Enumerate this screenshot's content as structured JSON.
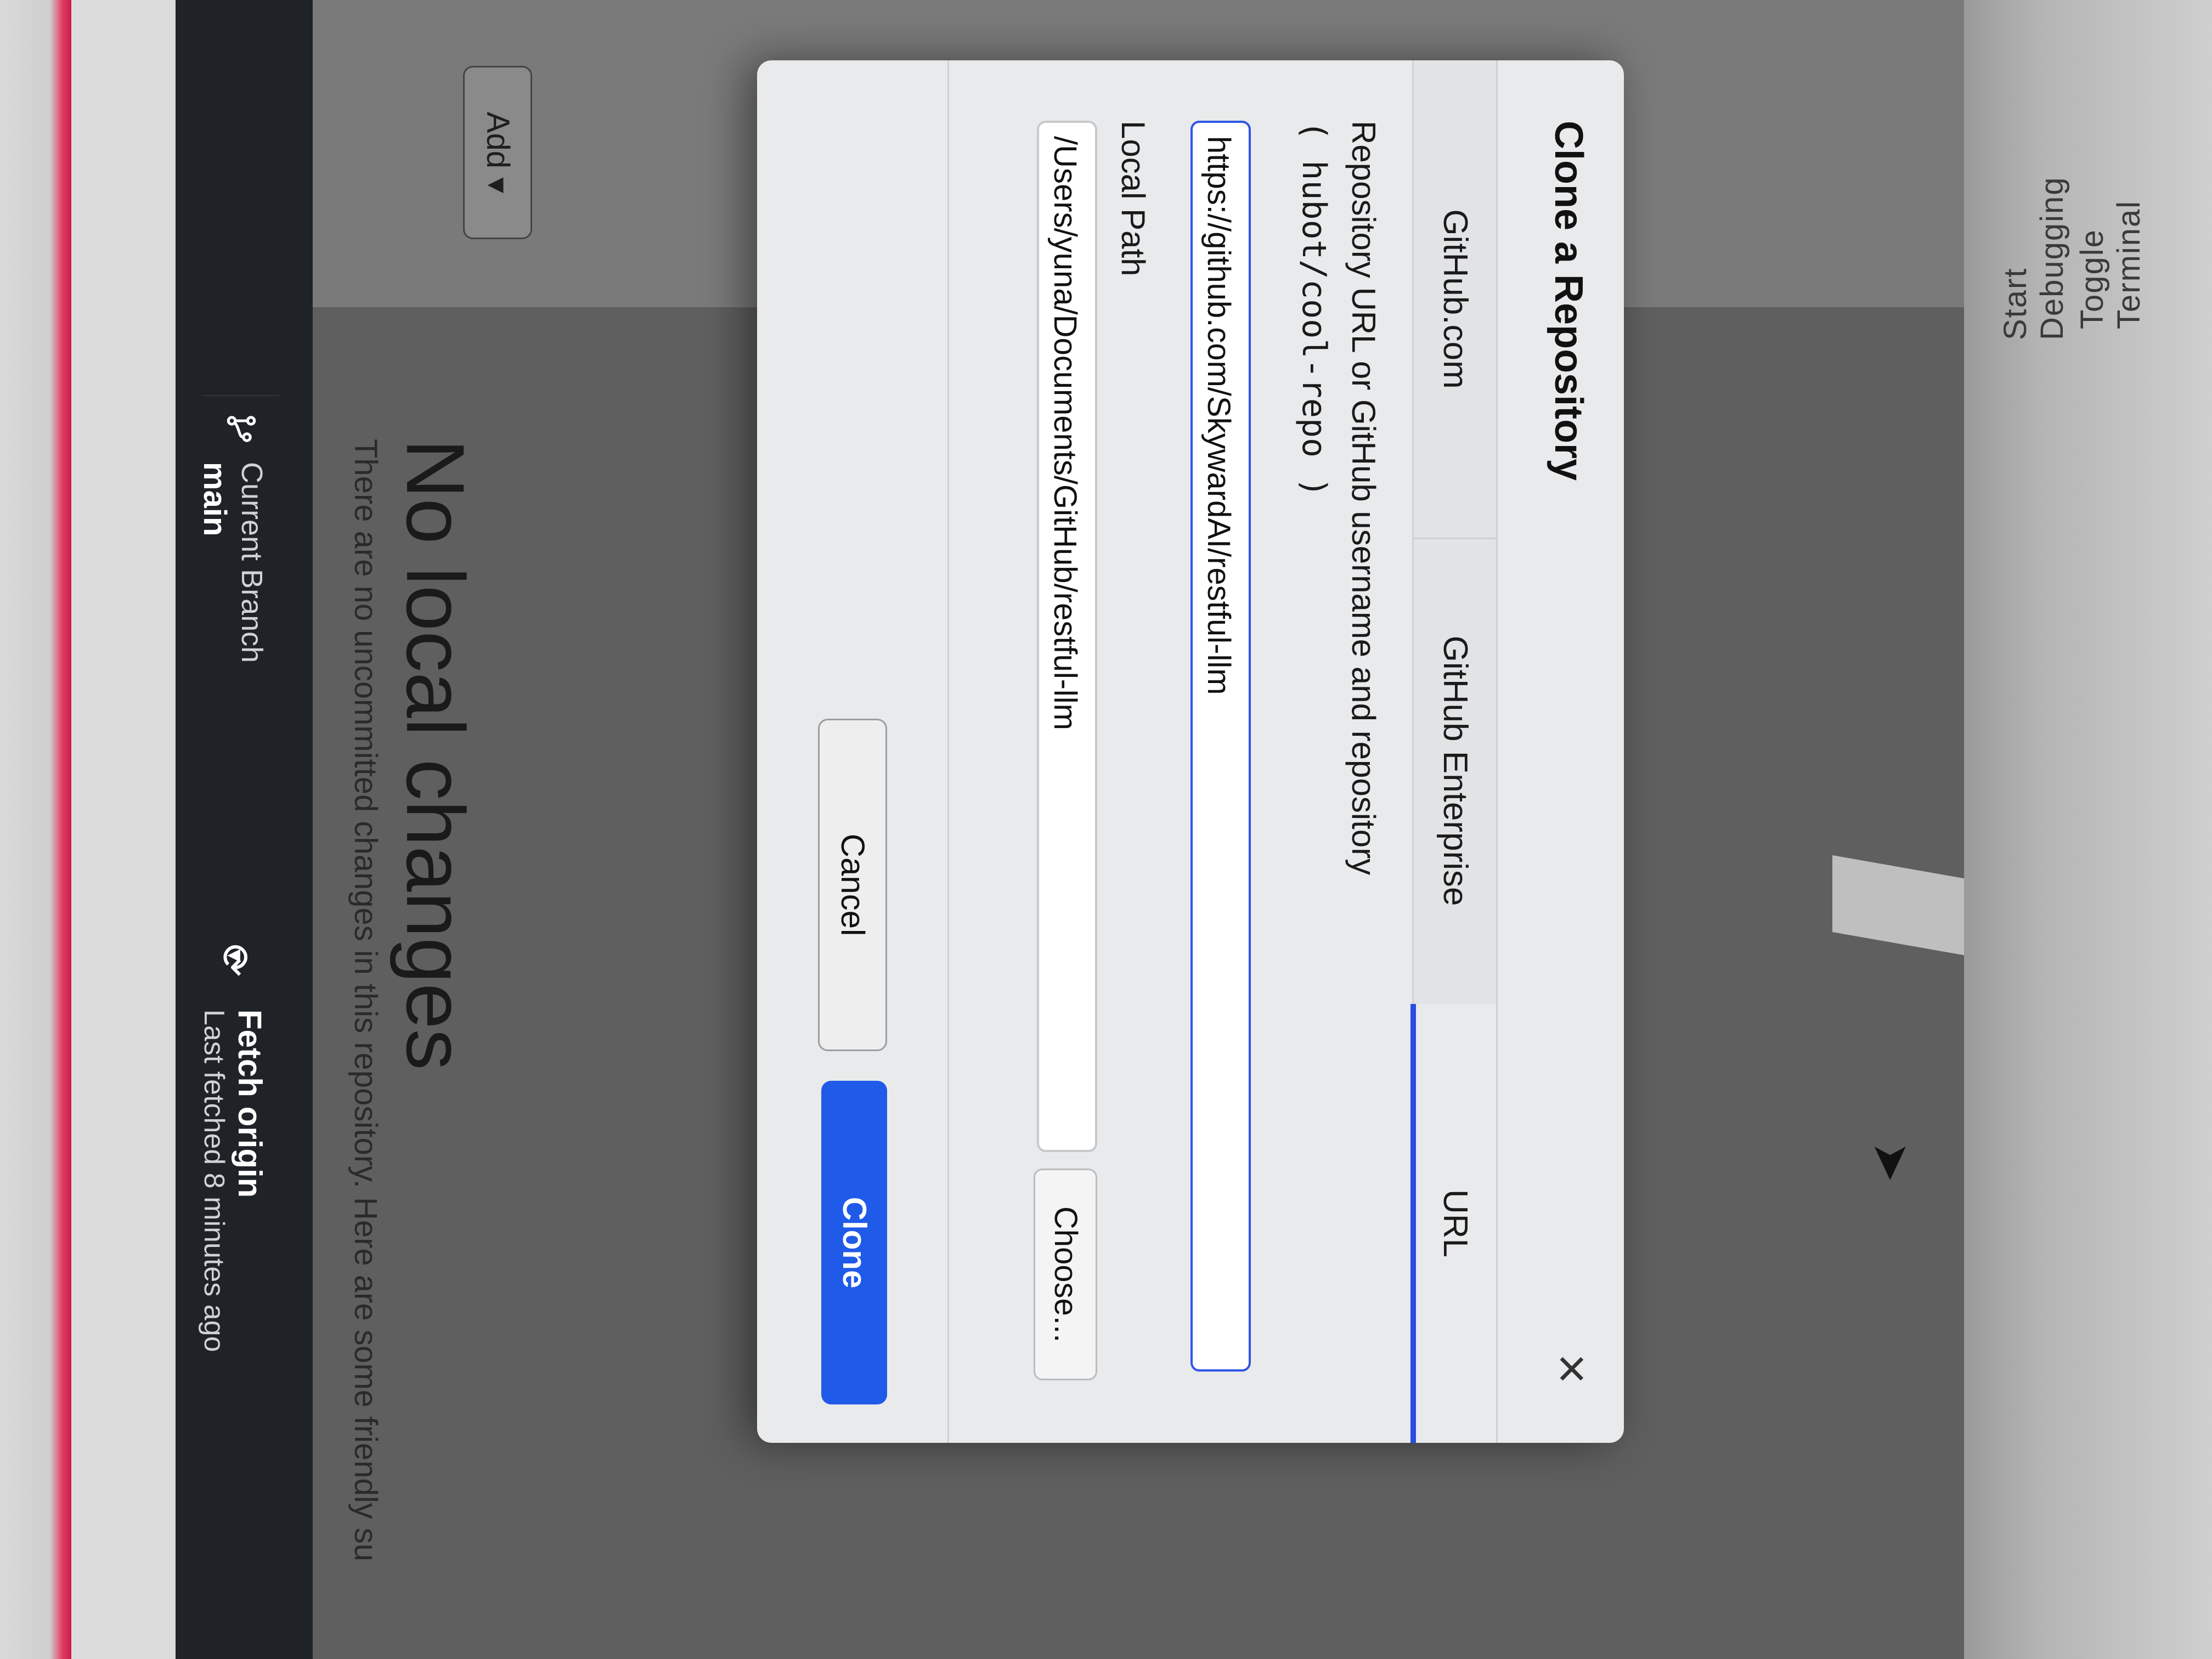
{
  "toolbar": {
    "current_branch_label": "Current Branch",
    "current_branch_value": "main",
    "fetch_label": "Fetch origin",
    "fetch_sub": "Last fetched 8 minutes ago"
  },
  "left_pane": {
    "add_label": "Add"
  },
  "main": {
    "title": "No local changes",
    "hint": "There are no uncommitted changes in this repository. Here are some friendly su"
  },
  "dialog": {
    "title": "Clone a Repository",
    "tabs": [
      {
        "label": "GitHub.com",
        "active": false
      },
      {
        "label": "GitHub Enterprise",
        "active": false
      },
      {
        "label": "URL",
        "active": true
      }
    ],
    "repo_label": "Repository URL or GitHub username and repository",
    "repo_hint": "( hubot/cool-repo )",
    "repo_value": "https://github.com/SkywardAI/restful-llm",
    "local_path_label": "Local Path",
    "local_path_value": "/Users/yuna/Documents/GitHub/restful-llm",
    "choose_label": "Choose...",
    "cancel_label": "Cancel",
    "clone_label": "Clone"
  },
  "commands": {
    "start_debugging": "Start Debugging",
    "toggle_terminal": "Toggle Terminal"
  },
  "colors": {
    "accent": "#1f5ae8",
    "toolbar_bg": "#1f2328"
  },
  "icons": [
    "branch-icon",
    "sync-icon",
    "close-icon",
    "caret-down-icon",
    "cursor-icon"
  ]
}
